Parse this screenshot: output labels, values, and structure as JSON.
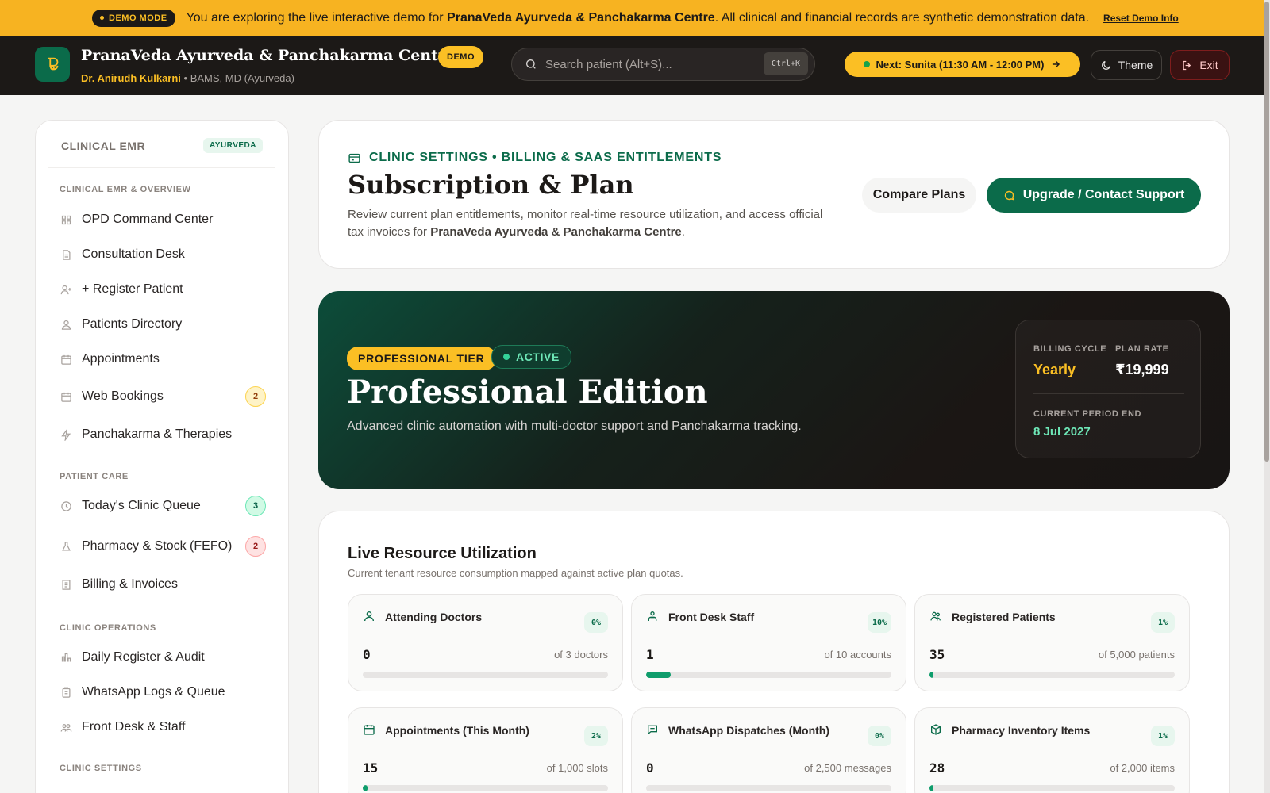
{
  "banner": {
    "mode_label": "DEMO MODE",
    "text_before": "You are exploring the live interactive demo for ",
    "clinic_bold": "PranaVeda Ayurveda & Panchakarma Centre",
    "text_after": ". All clinical and financial records are synthetic demonstration data.",
    "reset_link": "Reset Demo Info"
  },
  "header": {
    "clinic_name": "PranaVeda Ayurveda & Panchakarma Centre",
    "demo_badge": "DEMO",
    "doctor_name": "Dr. Anirudh Kulkarni",
    "doctor_sep": " • ",
    "doctor_qual": "BAMS, MD (Ayurveda)",
    "search_placeholder": "Search patient (Alt+S)...",
    "search_shortcut": "Ctrl+K",
    "next_label": "Next:",
    "next_value": "Sunita (11:30 AM - 12:00 PM)",
    "theme_label": "Theme",
    "exit_label": "Exit"
  },
  "sidebar": {
    "title": "CLINICAL EMR",
    "tag": "AYURVEDA",
    "sections": [
      {
        "label": "CLINICAL EMR & OVERVIEW"
      },
      {
        "label": "PATIENT CARE"
      },
      {
        "label": "CLINIC OPERATIONS"
      },
      {
        "label": "CLINIC SETTINGS"
      }
    ],
    "items": [
      {
        "label": "OPD Command Center",
        "icon": "grid-icon"
      },
      {
        "label": "Consultation Desk",
        "icon": "document-icon"
      },
      {
        "label": "+ Register Patient",
        "icon": "user-plus-icon"
      },
      {
        "label": "Patients Directory",
        "icon": "users-icon"
      },
      {
        "label": "Appointments",
        "icon": "calendar-icon"
      },
      {
        "label": "Web Bookings",
        "icon": "calendar-icon",
        "count": "2"
      },
      {
        "label": "Panchakarma & Therapies",
        "icon": "bolt-icon"
      },
      {
        "label": "Today's Clinic Queue",
        "icon": "clock-icon",
        "count": "3"
      },
      {
        "label": "Pharmacy & Stock (FEFO)",
        "icon": "flask-icon",
        "count": "2"
      },
      {
        "label": "Billing & Invoices",
        "icon": "receipt-icon"
      },
      {
        "label": "Daily Register & Audit",
        "icon": "bar-chart-icon"
      },
      {
        "label": "WhatsApp Logs & Queue",
        "icon": "clipboard-icon"
      },
      {
        "label": "Front Desk & Staff",
        "icon": "team-icon"
      }
    ]
  },
  "settings": {
    "eyebrow": "CLINIC SETTINGS • BILLING & SAAS ENTITLEMENTS",
    "title": "Subscription & Plan",
    "desc_before": "Review current plan entitlements, monitor real-time resource utilization, and access official tax invoices for ",
    "desc_bold": "PranaVeda Ayurveda & Panchakarma Centre",
    "desc_after": ".",
    "compare_label": "Compare Plans",
    "upgrade_label": "Upgrade / Contact Support"
  },
  "plan": {
    "tier": "PROFESSIONAL TIER",
    "status": "ACTIVE",
    "name": "Professional Edition",
    "description": "Advanced clinic automation with multi-doctor support and Panchakarma tracking.",
    "billing_cycle_label": "BILLING CYCLE",
    "billing_cycle": "Yearly",
    "plan_rate_label": "PLAN RATE",
    "plan_rate": "₹19,999",
    "period_end_label": "CURRENT PERIOD END",
    "period_end": "8 Jul 2027"
  },
  "utilization": {
    "title": "Live Resource Utilization",
    "subtitle": "Current tenant resource consumption mapped against active plan quotas.",
    "metrics": [
      {
        "label": "Attending Doctors",
        "icon": "user-icon",
        "pct": "0%",
        "fill": 0,
        "value": "0",
        "of": "of 3 doctors"
      },
      {
        "label": "Front Desk Staff",
        "icon": "staff-icon",
        "pct": "10%",
        "fill": 10,
        "value": "1",
        "of": "of 10 accounts"
      },
      {
        "label": "Registered Patients",
        "icon": "users-icon",
        "pct": "1%",
        "fill": 1,
        "value": "35",
        "of": "of 5,000 patients"
      },
      {
        "label": "Appointments (This Month)",
        "icon": "calendar-icon",
        "pct": "2%",
        "fill": 2,
        "value": "15",
        "of": "of 1,000 slots"
      },
      {
        "label": "WhatsApp Dispatches (Month)",
        "icon": "chat-icon",
        "pct": "0%",
        "fill": 0,
        "value": "0",
        "of": "of 2,500 messages"
      },
      {
        "label": "Pharmacy Inventory Items",
        "icon": "box-icon",
        "pct": "1%",
        "fill": 1,
        "value": "28",
        "of": "of 2,000 items"
      }
    ]
  },
  "colors": {
    "brand_green": "#0b6b4a",
    "accent_amber": "#fbbf24",
    "header_dark": "#1c1917"
  }
}
